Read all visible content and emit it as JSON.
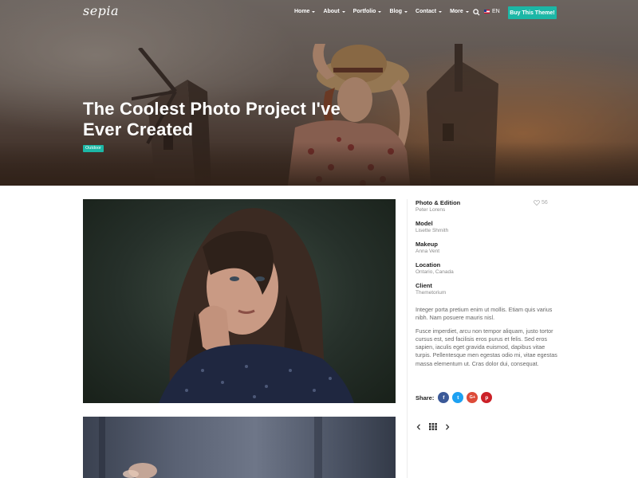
{
  "header": {
    "logo": "sepia",
    "menu": [
      {
        "label": "Home"
      },
      {
        "label": "About"
      },
      {
        "label": "Portfolio"
      },
      {
        "label": "Blog"
      },
      {
        "label": "Contact"
      },
      {
        "label": "More"
      }
    ],
    "language": "EN",
    "buy_button": "Buy This Theme!",
    "search_icon": "search-icon"
  },
  "hero": {
    "title_line1": "The Coolest Photo Project I've",
    "title_line2": "Ever Created",
    "tag": "Outdoor"
  },
  "project": {
    "likes": "56",
    "details": [
      {
        "label": "Photo & Edition",
        "value": "Peter Lorens"
      },
      {
        "label": "Model",
        "value": "Lisette Shmith"
      },
      {
        "label": "Makeup",
        "value": "Anna Vent"
      },
      {
        "label": "Location",
        "value": "Ontario, Canada"
      },
      {
        "label": "Client",
        "value": "Themetorium"
      }
    ],
    "paragraphs": [
      "Integer porta pretium enim ut mollis. Etiam quis varius nibh. Nam posuere mauris nisl.",
      "Fusce imperdiet, arcu non tempor aliquam, justo tortor cursus est, sed facilisis eros purus et felis. Sed eros sapien, iaculis eget gravida euismod, dapibus vitae turpis. Pellentesque men egestas odio mi, vitae egestas massa elementum ut. Cras dolor dui, consequat."
    ],
    "share_label": "Share:",
    "share": [
      {
        "icon": "facebook-icon",
        "glyph": "f",
        "color": "#3b5998"
      },
      {
        "icon": "twitter-icon",
        "glyph": "t",
        "color": "#1da1f2"
      },
      {
        "icon": "google-plus-icon",
        "glyph": "G+",
        "color": "#dd4b39"
      },
      {
        "icon": "pinterest-icon",
        "glyph": "p",
        "color": "#cb2027"
      }
    ]
  },
  "colors": {
    "accent": "#1cb7a6"
  }
}
